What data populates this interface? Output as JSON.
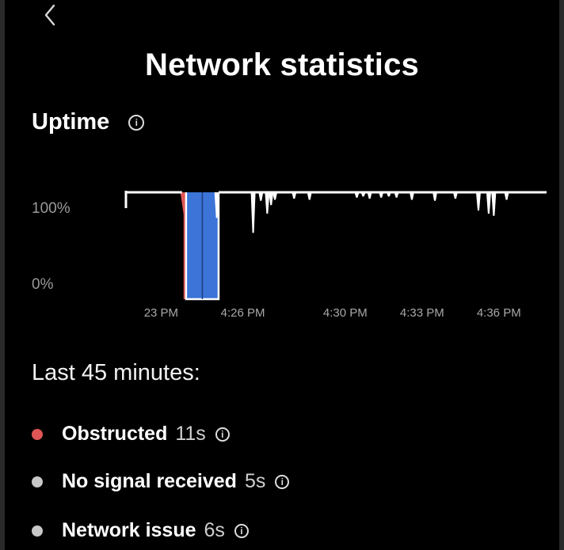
{
  "header": {
    "back_icon": "chevron-left-icon",
    "title": "Network statistics"
  },
  "uptime": {
    "title": "Uptime",
    "info_icon": "info-icon"
  },
  "chart_data": {
    "type": "area",
    "xlabel": "",
    "ylabel": "",
    "ylim": [
      0,
      100
    ],
    "y_tick_labels": [
      "100%",
      "0%"
    ],
    "x_tick_labels": [
      "23 PM",
      "4:26 PM",
      "4:30 PM",
      "4:33 PM",
      "4:36 PM"
    ],
    "x_minutes": [
      0,
      3,
      7,
      10,
      13
    ],
    "window_minutes": [
      -1.6,
      14.8
    ],
    "colors": {
      "uptime": "#ffffff",
      "obstructed": "#e05555",
      "no_signal": "#3c74d8"
    },
    "uptime_dips": [
      {
        "minute": 1.98,
        "value": 76
      },
      {
        "minute": 3.4,
        "value": 62
      },
      {
        "minute": 3.7,
        "value": 92
      },
      {
        "minute": 3.95,
        "value": 80
      },
      {
        "minute": 4.1,
        "value": 88
      },
      {
        "minute": 4.25,
        "value": 93
      },
      {
        "minute": 5.0,
        "value": 94
      },
      {
        "minute": 5.6,
        "value": 93
      },
      {
        "minute": 7.45,
        "value": 95
      },
      {
        "minute": 7.7,
        "value": 96
      },
      {
        "minute": 7.95,
        "value": 94
      },
      {
        "minute": 8.4,
        "value": 95
      },
      {
        "minute": 8.7,
        "value": 96
      },
      {
        "minute": 9.0,
        "value": 95
      },
      {
        "minute": 9.6,
        "value": 93
      },
      {
        "minute": 10.5,
        "value": 92
      },
      {
        "minute": 11.3,
        "value": 94
      },
      {
        "minute": 12.2,
        "value": 83
      },
      {
        "minute": 12.6,
        "value": 80
      },
      {
        "minute": 12.8,
        "value": 78
      },
      {
        "minute": 13.3,
        "value": 93
      }
    ],
    "outages": [
      {
        "type": "obstructed",
        "start_minute": 0.62,
        "end_minute": 0.78
      },
      {
        "type": "no_signal",
        "start_minute": 0.78,
        "end_minute": 2.05
      }
    ]
  },
  "summary": {
    "heading": "Last 45 minutes:",
    "items": [
      {
        "label": "Obstructed",
        "value": "11s",
        "color": "#e05555",
        "icon": "info-icon"
      },
      {
        "label": "No signal received",
        "value": "5s",
        "color": "#c8c8c8",
        "icon": "info-icon"
      },
      {
        "label": "Network issue",
        "value": "6s",
        "color": "#c8c8c8",
        "icon": "info-icon"
      }
    ]
  }
}
